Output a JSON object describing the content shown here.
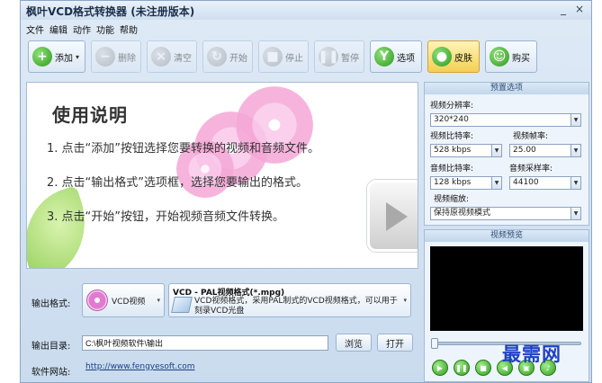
{
  "window": {
    "title": "枫叶VCD格式转换器   (未注册版本)",
    "minimize_glyph": "_",
    "close_glyph": "×"
  },
  "menu": [
    "文件",
    "编辑",
    "动作",
    "功能",
    "帮助"
  ],
  "toolbar": {
    "add": "添加",
    "remove": "删除",
    "clear": "清空",
    "start": "开始",
    "stop": "停止",
    "pause": "暂停",
    "options": "选项",
    "skin": "皮肤",
    "buy": "购买"
  },
  "instructions": {
    "title": "使用说明",
    "steps": [
      "1. 点击“添加”按钮选择您要转换的视频和音频文件。",
      "2. 点击“输出格式”选项框，选择您要输出的格式。",
      "3. 点击“开始”按钮，开始视频音频文件转换。"
    ]
  },
  "output": {
    "format_label": "输出格式:",
    "format_value": "VCD视频",
    "format_title": "VCD - PAL视频格式(*.mpg)",
    "format_desc": "VCD视频格式，采用PAL制式的VCD视频格式，可以用于刻录VCD光盘",
    "dir_label": "输出目录:",
    "dir_value": "C:\\枫叶视频软件\\输出",
    "browse": "浏览",
    "open": "打开",
    "site_label": "软件网站:",
    "site_url": "http://www.fengyesoft.com"
  },
  "preset": {
    "title": "预置选项",
    "resolution_label": "视频分辨率:",
    "resolution": "320*240",
    "vbitrate_label": "视频比特率:",
    "vbitrate": "528 kbps",
    "framerate_label": "视频帧率:",
    "framerate": "25.00",
    "abitrate_label": "音频比特率:",
    "abitrate": "128 kbps",
    "samplerate_label": "音频采样率:",
    "samplerate": "44100",
    "scale_label": "视频缩放:",
    "scale": "保持原视频模式"
  },
  "preview": {
    "title": "视频预览",
    "position": 0
  },
  "watermark": "最需网",
  "colors": {
    "accent_green": "#2c9a1c",
    "watermark_blue": "#1f40c8"
  }
}
